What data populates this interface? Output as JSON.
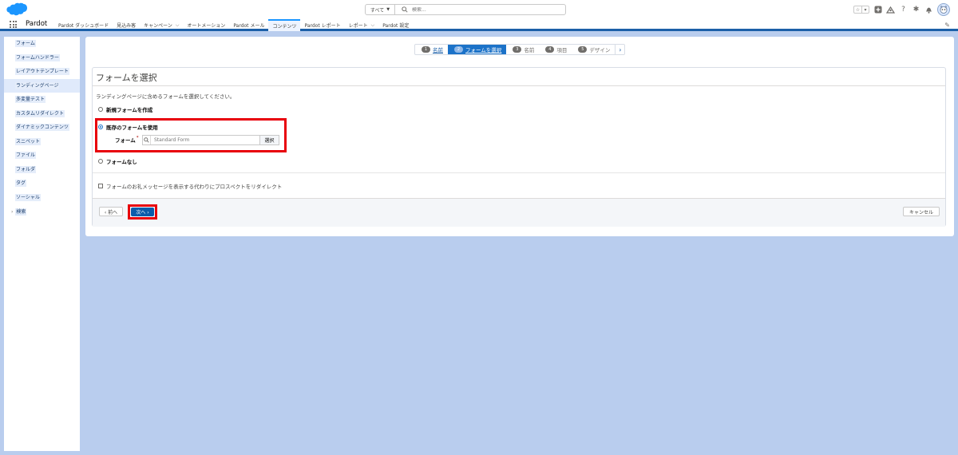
{
  "header": {
    "logo": "salesforce-cloud-logo",
    "search_scope": "すべて",
    "search_placeholder": "検索...",
    "icons": [
      "star-icon",
      "plus-icon",
      "trailhead-icon",
      "help-icon",
      "gear-icon",
      "bell-icon",
      "avatar"
    ]
  },
  "nav": {
    "app_name": "Pardot",
    "items": [
      {
        "label": "Pardot ダッシュボード",
        "has_menu": false
      },
      {
        "label": "見込み客",
        "has_menu": false
      },
      {
        "label": "キャンペーン",
        "has_menu": true
      },
      {
        "label": "オートメーション",
        "has_menu": false
      },
      {
        "label": "Pardot メール",
        "has_menu": false
      },
      {
        "label": "コンテンツ",
        "has_menu": false,
        "active": true
      },
      {
        "label": "Pardot レポート",
        "has_menu": false
      },
      {
        "label": "レポート",
        "has_menu": true
      },
      {
        "label": "Pardot 設定",
        "has_menu": false
      }
    ]
  },
  "sidebar": {
    "items": [
      {
        "label": "フォーム"
      },
      {
        "label": "フォームハンドラー"
      },
      {
        "label": "レイアウトテンプレート"
      },
      {
        "label": "ランディングページ",
        "active": true
      },
      {
        "label": "多変量テスト"
      },
      {
        "label": "カスタムリダイレクト"
      },
      {
        "label": "ダイナミックコンテンツ"
      },
      {
        "label": "スニペット"
      },
      {
        "label": "ファイル"
      },
      {
        "label": "フォルダ"
      },
      {
        "label": "タグ"
      },
      {
        "label": "ソーシャル"
      },
      {
        "label": "検索",
        "expandable": true
      }
    ]
  },
  "wizard": {
    "steps": [
      {
        "num": "1",
        "label": "名前",
        "state": "done"
      },
      {
        "num": "2",
        "label": "フォームを選択",
        "state": "current"
      },
      {
        "num": "3",
        "label": "名前",
        "state": "todo"
      },
      {
        "num": "4",
        "label": "項目",
        "state": "todo"
      },
      {
        "num": "5",
        "label": "デザイン",
        "state": "todo"
      }
    ],
    "next_arrow": "›"
  },
  "form": {
    "title": "フォームを選択",
    "description": "ランディングページに含めるフォームを選択してください。",
    "option_new": "新規フォームを作成",
    "option_existing": "既存のフォームを使用",
    "field_label": "フォーム",
    "required_mark": "*",
    "lookup_placeholder": "Standard Form",
    "lookup_button": "選択",
    "option_none": "フォームなし",
    "redirect_checkbox": "フォームのお礼メッセージを表示する代わりにプロスペクトをリダイレクト",
    "selected_option": "existing"
  },
  "footer": {
    "prev_label": "‹ 前へ",
    "next_label": "次へ ›",
    "cancel_label": "キャンセル"
  },
  "colors": {
    "accent": "#1b72c8",
    "highlight": "#e8000b",
    "page_bg": "#b9cdee"
  }
}
